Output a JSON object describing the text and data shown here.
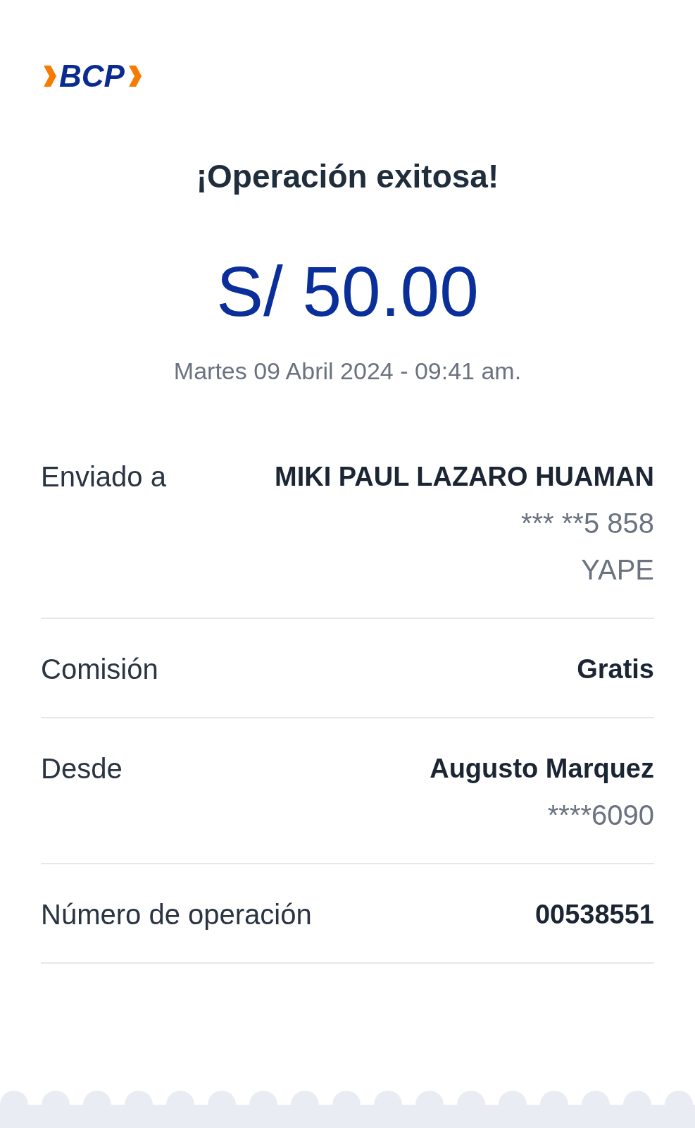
{
  "logo": {
    "text": "BCP"
  },
  "title": "¡Operación exitosa!",
  "amount": "S/ 50.00",
  "datetime": "Martes 09 Abril 2024 - 09:41 am.",
  "details": [
    {
      "label": "Enviado a",
      "value": "MIKI PAUL LAZARO HUAMAN",
      "sub_lines": [
        "*** **5 858",
        "YAPE"
      ]
    },
    {
      "label": "Comisión",
      "value": "Gratis"
    },
    {
      "label": "Desde",
      "value": "Augusto Marquez",
      "sub_lines": [
        "****6090"
      ]
    },
    {
      "label": "Número de operación",
      "value": "00538551"
    }
  ]
}
